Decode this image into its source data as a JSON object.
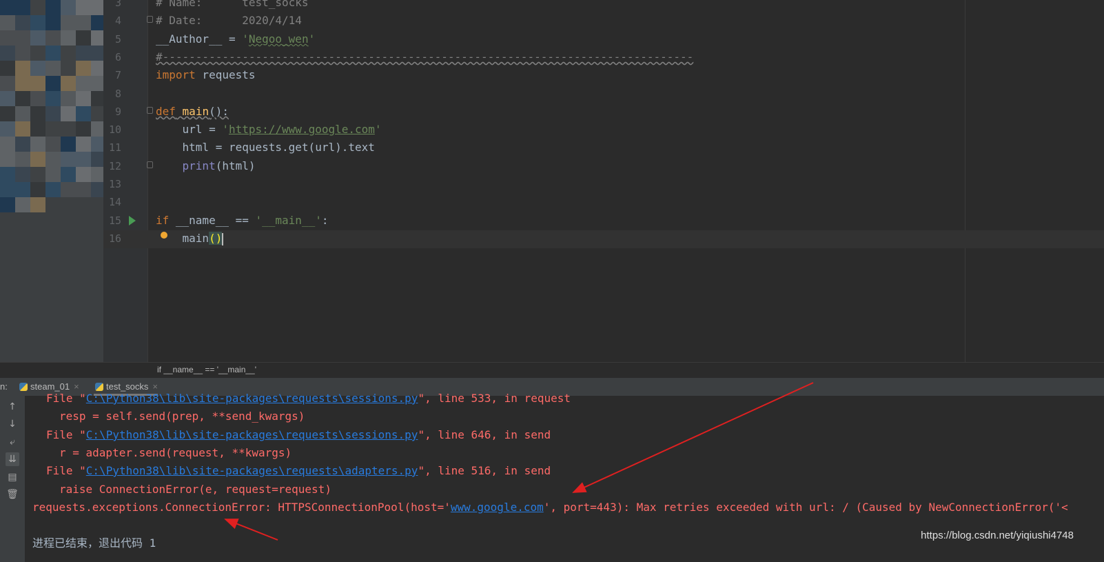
{
  "editor": {
    "lines": [
      {
        "n": "3",
        "tokens": [
          {
            "t": "# Name:      test_socks",
            "c": "c"
          }
        ]
      },
      {
        "n": "4",
        "tokens": [
          {
            "t": "# Date:      2020/4/14",
            "c": "c"
          }
        ]
      },
      {
        "n": "5",
        "tokens": [
          {
            "t": "__Author__ = ",
            "c": ""
          },
          {
            "t": "'",
            "c": "s"
          },
          {
            "t": "Negoo_wen",
            "c": "s w"
          },
          {
            "t": "'",
            "c": "s"
          }
        ]
      },
      {
        "n": "6",
        "tokens": [
          {
            "t": "#--------------------------------------------------------------------------------",
            "c": "c wc"
          }
        ]
      },
      {
        "n": "7",
        "tokens": [
          {
            "t": "import",
            "c": "k"
          },
          {
            "t": " requests",
            "c": ""
          }
        ]
      },
      {
        "n": "8",
        "tokens": []
      },
      {
        "n": "9",
        "tokens": [
          {
            "t": "def",
            "c": "k wc"
          },
          {
            "t": " ",
            "c": "wc"
          },
          {
            "t": "main",
            "c": "f wc"
          },
          {
            "t": "():",
            "c": "wc"
          }
        ]
      },
      {
        "n": "10",
        "tokens": [
          {
            "t": "    url = ",
            "c": ""
          },
          {
            "t": "'",
            "c": "s"
          },
          {
            "t": "https://www.google.com",
            "c": "s u"
          },
          {
            "t": "'",
            "c": "s"
          }
        ]
      },
      {
        "n": "11",
        "tokens": [
          {
            "t": "    html = requests.get(url).text",
            "c": ""
          }
        ]
      },
      {
        "n": "12",
        "tokens": [
          {
            "t": "    ",
            "c": ""
          },
          {
            "t": "print",
            "c": "b"
          },
          {
            "t": "(html)",
            "c": ""
          }
        ]
      },
      {
        "n": "13",
        "tokens": []
      },
      {
        "n": "14",
        "tokens": []
      },
      {
        "n": "15",
        "tokens": [
          {
            "t": "if",
            "c": "k"
          },
          {
            "t": " __name__ == ",
            "c": ""
          },
          {
            "t": "'__main__'",
            "c": "s"
          },
          {
            "t": ":",
            "c": ""
          }
        ]
      },
      {
        "n": "16",
        "tokens": [
          {
            "t": "    main",
            "c": ""
          },
          {
            "t": "()",
            "c": "bm"
          }
        ]
      }
    ]
  },
  "breadcrumb": "if __name__ == '__main__'",
  "run_tabs": {
    "prefix": "n:",
    "tabs": [
      {
        "label": "steam_01",
        "active": false
      },
      {
        "label": "test_socks",
        "active": true
      }
    ]
  },
  "console": {
    "lines": [
      {
        "indent": "67",
        "parts": [
          {
            "t": "File \"",
            "c": ""
          },
          {
            "t": "C:\\Python38\\lib\\site-packages\\requests\\sessions.py",
            "c": "lnk"
          },
          {
            "t": "\", line 533, in request",
            "c": ""
          }
        ]
      },
      {
        "indent": "86",
        "parts": [
          {
            "t": "resp = self.send(prep, **send_kwargs)",
            "c": ""
          }
        ]
      },
      {
        "indent": "67",
        "parts": [
          {
            "t": "File \"",
            "c": ""
          },
          {
            "t": "C:\\Python38\\lib\\site-packages\\requests\\sessions.py",
            "c": "lnk"
          },
          {
            "t": "\", line 646, in send",
            "c": ""
          }
        ]
      },
      {
        "indent": "86",
        "parts": [
          {
            "t": "r = adapter.send(request, **kwargs)",
            "c": ""
          }
        ]
      },
      {
        "indent": "67",
        "parts": [
          {
            "t": "File \"",
            "c": ""
          },
          {
            "t": "C:\\Python38\\lib\\site-packages\\requests\\adapters.py",
            "c": "lnk"
          },
          {
            "t": "\", line 516, in send",
            "c": ""
          }
        ]
      },
      {
        "indent": "86",
        "parts": [
          {
            "t": "raise ConnectionError(e, request=request)",
            "c": ""
          }
        ]
      },
      {
        "indent": "47",
        "parts": [
          {
            "t": "requests.exceptions.ConnectionError: HTTPSConnectionPool(host='",
            "c": ""
          },
          {
            "t": "www.google.com",
            "c": "lnk"
          },
          {
            "t": "', port=443): Max retries exceeded with url: / (Caused by NewConnectionError('<",
            "c": ""
          }
        ]
      },
      {
        "indent": "47",
        "parts": []
      },
      {
        "indent": "47",
        "parts": [
          {
            "t": "进程已结束，退出代码 1",
            "c": "grey"
          }
        ]
      }
    ]
  },
  "toolbar_icons": [
    "arrow-up-icon",
    "arrow-down-icon",
    "soft-wrap-icon",
    "scroll-to-end-icon",
    "print-icon",
    "trash-icon"
  ],
  "watermark": "https://blog.csdn.net/yiqiushi4748",
  "colors": {
    "error": "#ff6b68",
    "link": "#287bde",
    "keyword": "#cc7832",
    "string": "#6a8759",
    "annotation_arrow": "#e02020"
  }
}
